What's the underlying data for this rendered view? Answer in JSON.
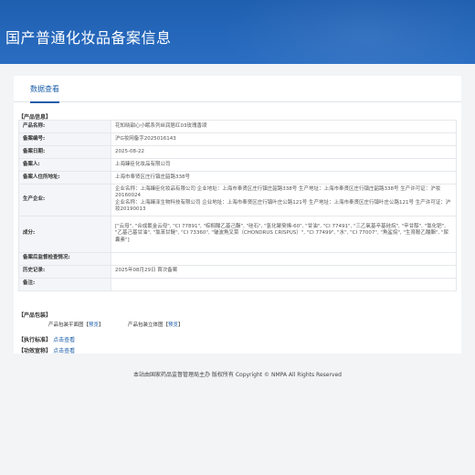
{
  "banner": {
    "title": "国产普通化妆品备案信息"
  },
  "tabs": [
    {
      "label": "数据查看"
    }
  ],
  "product_info": {
    "section_title": "产品信息",
    "rows": [
      {
        "label": "产品名称:",
        "value": "花知晓甜心小眠系列丝润唇红03玫瑰香颂"
      },
      {
        "label": "备案编号:",
        "value": "沪G妆网备字2025016143"
      },
      {
        "label": "备案日期:",
        "value": "2025-08-22"
      },
      {
        "label": "备案人:",
        "value": "上海臻臣化妆品有限公司"
      },
      {
        "label": "备案人住所地址:",
        "value": "上海市奉贤区庄行镇庄韶路338号"
      },
      {
        "label": "生产企业:",
        "value": "企业名称：上海臻臣化妆品有限公司 企业地址：上海市奉贤区庄行镇庄韶路338号 生产地址：上海市奉贤区庄行镇庄韶路338号 生产许可证：沪妆20160024\n企业名称：上海臻泽生物科技有限公司 企业地址：上海市奉贤区庄行镇叶庄公路121号 生产地址：上海市奉贤区庄行镇叶庄公路121号 生产许可证：沪妆20190013"
      },
      {
        "label": "成分:",
        "value": "[\"云母\", \"合成氟金云母\", \"CI 77891\", \"棕榈酸乙基己酯\", \"硅石\", \"氢化聚癸烯-60\", \"甘油\", \"CI 77491\", \"三乙氧基辛基硅烷\", \"辛甘醇\", \"氯化钯\", \"乙基己基甘油\", \"氯苯甘醚\", \"CI 73360\", \"皱波角叉菜（CHONDRUS CRISPUS）\", \"CI 77499\", \"水\", \"CI 77007\", \"角鲨烷\", \"生育酚乙酸酯\", \"尿囊素\"]"
      },
      {
        "label": "备案后监督检查情况:",
        "value": ""
      },
      {
        "label": "历史记录:",
        "value": "2025年08月29日 首次备案"
      },
      {
        "label": "备注:",
        "value": ""
      }
    ]
  },
  "packaging": {
    "section_title": "产品包装",
    "items": [
      {
        "label": "产品包装平面图",
        "link": "预览"
      },
      {
        "label": "产品包装立体图",
        "link": "预览"
      }
    ]
  },
  "standard": {
    "section_title": "执行标准",
    "link": "点击查看"
  },
  "efficacy": {
    "section_title": "功效宣称",
    "link": "点击查看"
  },
  "footer": {
    "text": "本站由国家药品监督管理局主办 版权所有 Copyright © NMPA All Rights Reserved"
  }
}
